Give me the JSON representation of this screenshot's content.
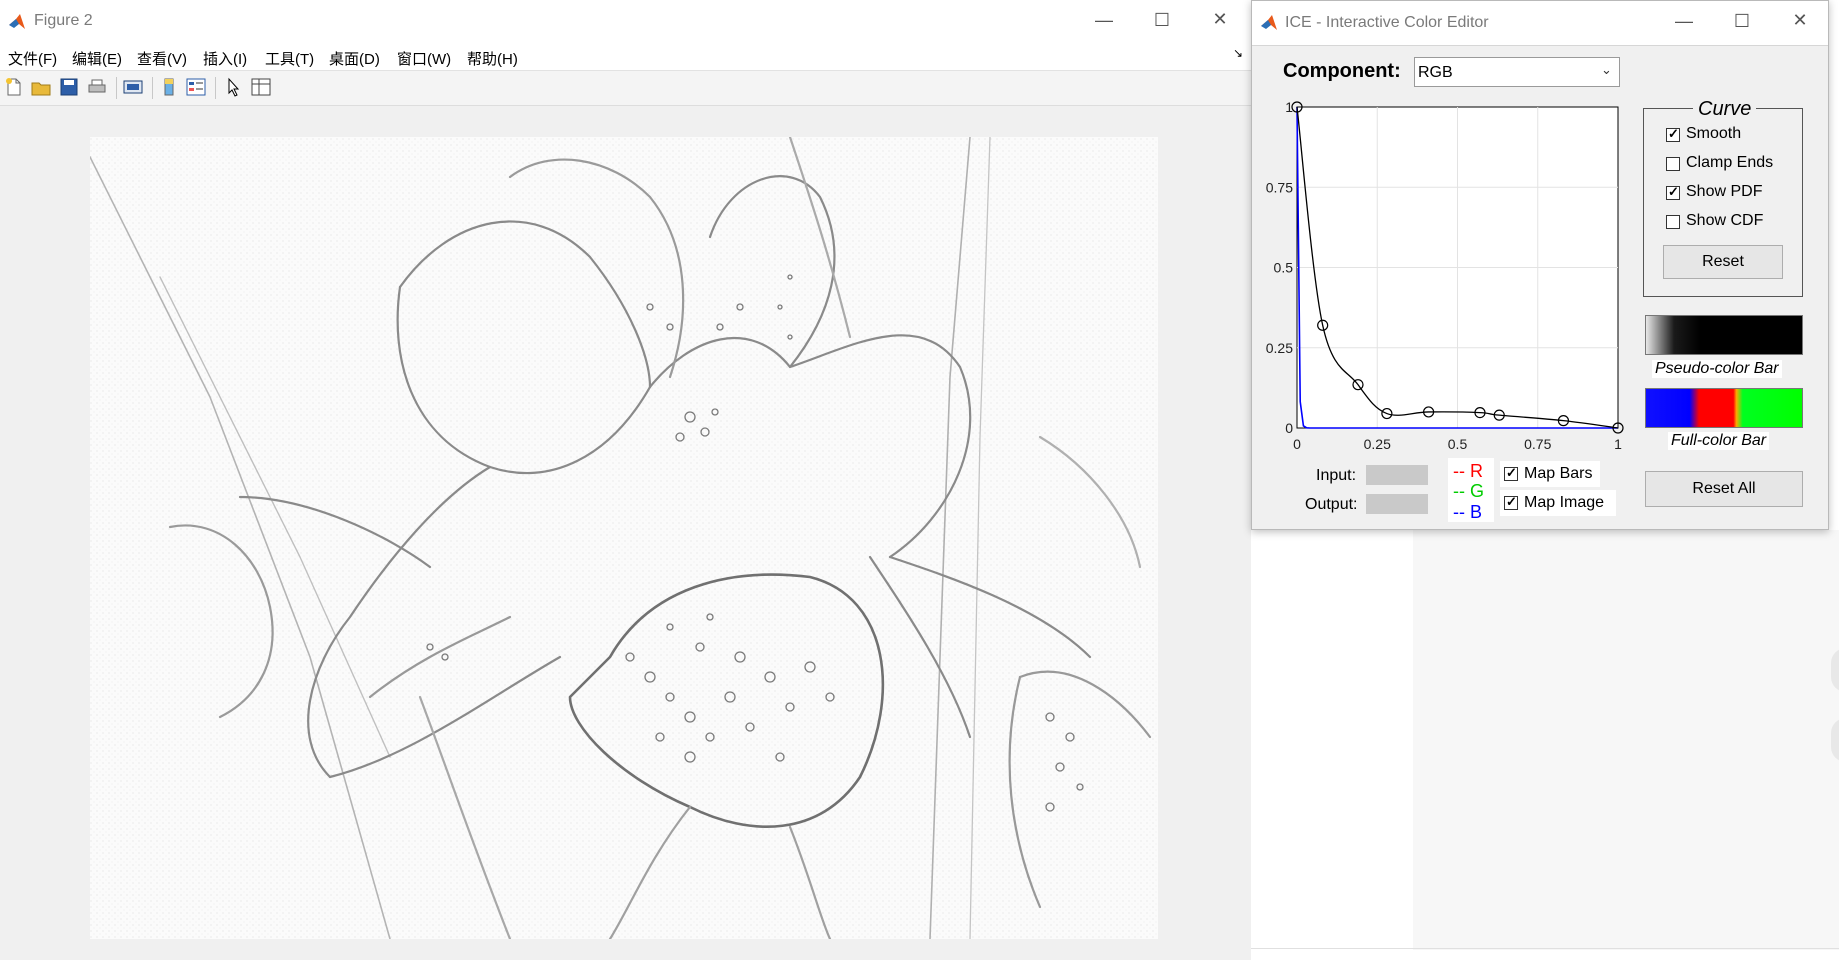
{
  "figure": {
    "title": "Figure 2",
    "menu": [
      "文件(F)",
      "编辑(E)",
      "查看(V)",
      "插入(I)",
      "工具(T)",
      "桌面(D)",
      "窗口(W)",
      "帮助(H)"
    ],
    "toolbar_icons": [
      "new-file-icon",
      "open-folder-icon",
      "save-icon",
      "print-icon",
      "print-preview-icon",
      "colorbar-icon",
      "legend-icon",
      "pointer-icon",
      "property-editor-icon"
    ]
  },
  "ice": {
    "title": "ICE - Interactive Color Editor",
    "component_label": "Component:",
    "component_value": "RGB",
    "curve_group_title": "Curve",
    "checkboxes": [
      {
        "label": "Smooth",
        "checked": true
      },
      {
        "label": "Clamp Ends",
        "checked": false
      },
      {
        "label": "Show PDF",
        "checked": true
      },
      {
        "label": "Show CDF",
        "checked": false
      }
    ],
    "reset_label": "Reset",
    "pseudo_color_bar_label": "Pseudo-color Bar",
    "full_color_bar_label": "Full-color Bar",
    "reset_all_label": "Reset All",
    "input_label": "Input:",
    "output_label": "Output:",
    "legend": [
      {
        "text": "-- R",
        "color": "#ff0000"
      },
      {
        "text": "-- G",
        "color": "#00cc00"
      },
      {
        "text": "-- B",
        "color": "#0000ff"
      }
    ],
    "map_bars": {
      "label": "Map Bars",
      "checked": true
    },
    "map_image": {
      "label": "Map Image",
      "checked": true
    }
  },
  "chart_data": {
    "type": "line",
    "xlim": [
      0,
      1
    ],
    "ylim": [
      0,
      1
    ],
    "xticks": [
      "0",
      "0.25",
      "0.5",
      "0.75",
      "1"
    ],
    "yticks": [
      "0",
      "0.25",
      "0.5",
      "0.75",
      "1"
    ],
    "grid": true,
    "control_points": [
      {
        "x": 0.0,
        "y": 1.0
      },
      {
        "x": 0.08,
        "y": 0.32
      },
      {
        "x": 0.19,
        "y": 0.135
      },
      {
        "x": 0.28,
        "y": 0.045
      },
      {
        "x": 0.41,
        "y": 0.05
      },
      {
        "x": 0.57,
        "y": 0.048
      },
      {
        "x": 0.63,
        "y": 0.04
      },
      {
        "x": 0.83,
        "y": 0.023
      },
      {
        "x": 1.0,
        "y": 0.0
      }
    ],
    "curve_color": "#000000",
    "pdf_color": "#0000ff"
  }
}
